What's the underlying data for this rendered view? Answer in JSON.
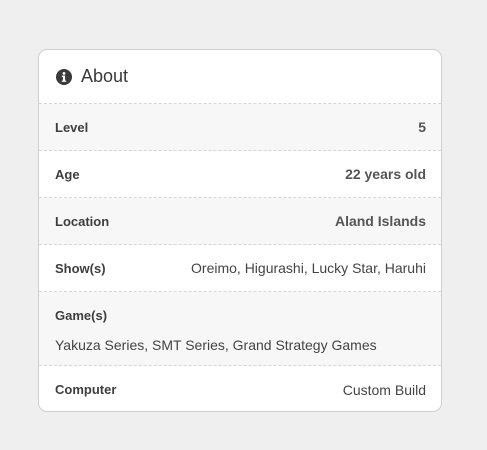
{
  "card": {
    "title": "About",
    "header_icon": "info-circle-icon"
  },
  "rows": {
    "level": {
      "label": "Level",
      "value": "5"
    },
    "age": {
      "label": "Age",
      "value": "22 years old"
    },
    "location": {
      "label": "Location",
      "value": "Aland Islands"
    },
    "shows": {
      "label": "Show(s)",
      "value": "Oreimo, Higurashi, Lucky Star, Haruhi"
    },
    "games": {
      "label": "Game(s)",
      "value": "Yakuza Series, SMT Series, Grand Strategy Games"
    },
    "computer": {
      "label": "Computer",
      "value": "Custom Build"
    }
  },
  "colors": {
    "background": "#efefef",
    "card": "#ffffff",
    "alt_row": "#f7f7f7",
    "text": "#444444"
  }
}
